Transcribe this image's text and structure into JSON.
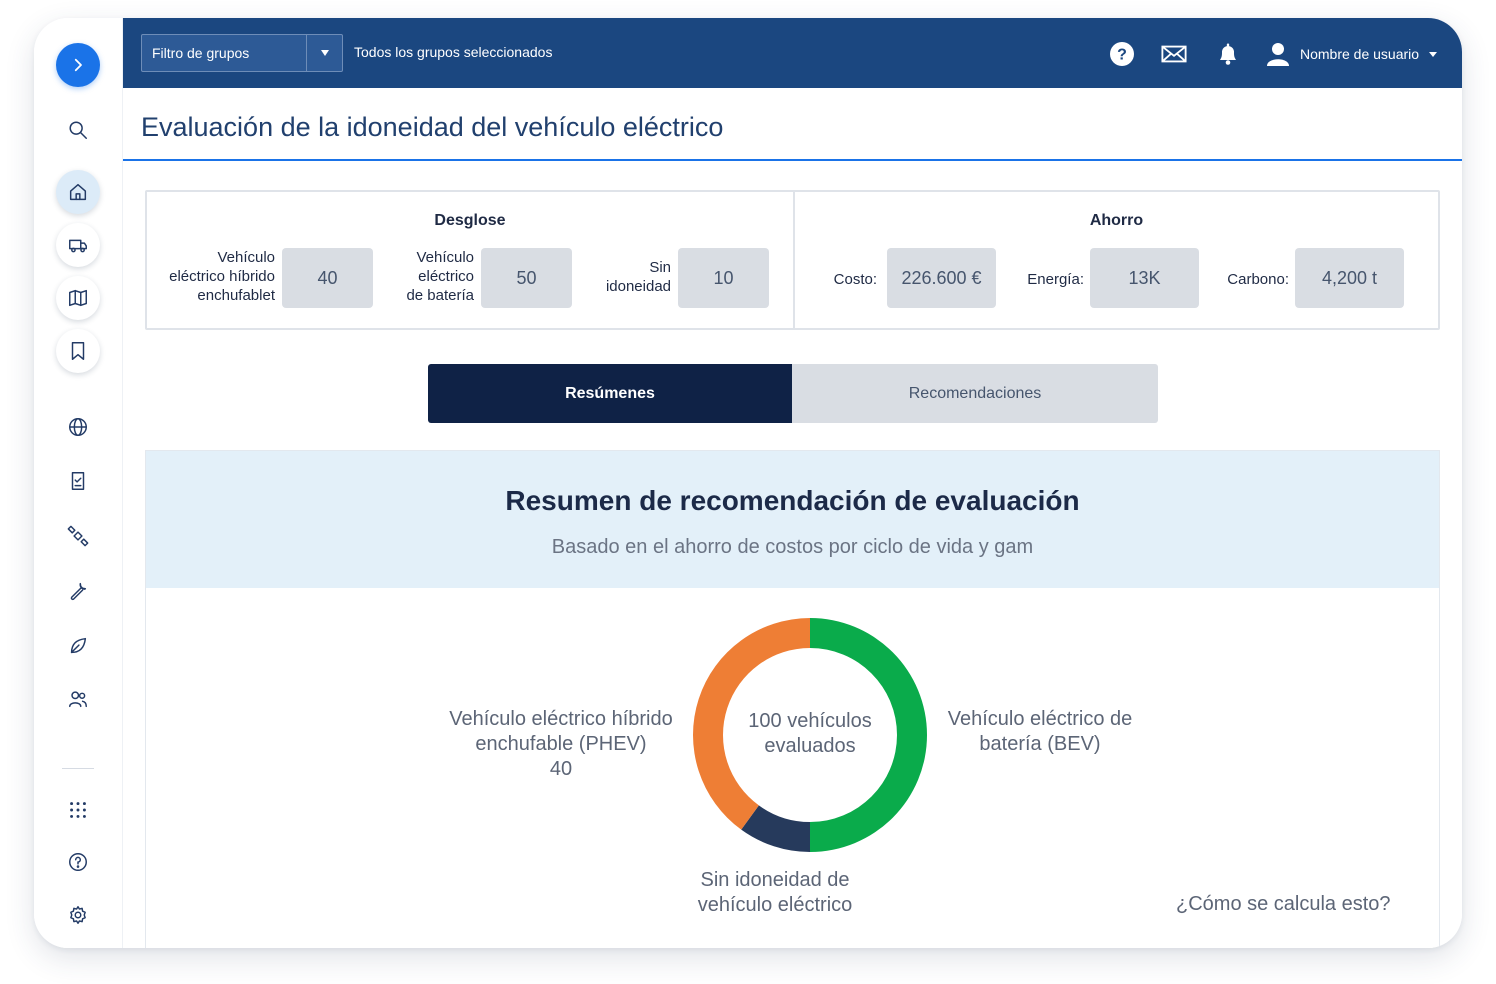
{
  "topbar": {
    "group_filter_label": "Filtro de grupos",
    "group_status": "Todos los grupos seleccionados",
    "help_icon": "question-circle-icon",
    "mail_icon": "envelope-icon",
    "bell_icon": "bell-icon",
    "user_icon": "user-icon",
    "username": "Nombre de usuario"
  },
  "sidebar": {
    "items": [
      {
        "icon": "expand-arrow-icon"
      },
      {
        "icon": "search-icon"
      },
      {
        "icon": "home-icon",
        "active": true
      },
      {
        "icon": "truck-icon"
      },
      {
        "icon": "map-icon"
      },
      {
        "icon": "bookmark-icon"
      },
      {
        "icon": "globe-icon"
      },
      {
        "icon": "report-icon"
      },
      {
        "icon": "satellite-icon"
      },
      {
        "icon": "wrench-icon"
      },
      {
        "icon": "leaf-icon"
      },
      {
        "icon": "users-icon"
      },
      {
        "icon": "apps-grid-icon"
      },
      {
        "icon": "help-icon"
      },
      {
        "icon": "settings-icon"
      }
    ]
  },
  "page": {
    "title": "Evaluación de la idoneidad del vehículo eléctrico"
  },
  "breakdown": {
    "title": "Desglose",
    "phev_label_1": "Vehículo",
    "phev_label_2": "eléctrico híbrido",
    "phev_label_3": "enchufablet",
    "phev_value": "40",
    "bev_label_1": "Vehículo",
    "bev_label_2": "eléctrico",
    "bev_label_3": "de batería",
    "bev_value": "50",
    "none_label_1": "Sin",
    "none_label_2": "idoneidad",
    "none_value": "10"
  },
  "savings": {
    "title": "Ahorro",
    "cost_label": "Costo:",
    "cost_value": "226.600 €",
    "energy_label": "Energía:",
    "energy_value": "13K",
    "carbon_label": "Carbono:",
    "carbon_value": "4,200 t"
  },
  "tabs": {
    "summaries": "Resúmenes",
    "recommendations": "Recomendaciones"
  },
  "card": {
    "title": "Resumen de recomendación de evaluación",
    "subtitle": "Basado en el ahorro de costos por ciclo de vida y gam",
    "center_line1": "100 vehículos",
    "center_line2": "evaluados",
    "phev_line1": "Vehículo eléctrico híbrido",
    "phev_line2": "enchufable (PHEV)",
    "phev_count": "40",
    "bev_line1": "Vehículo eléctrico de",
    "bev_line2": "batería (BEV)",
    "none_line1": "Sin idoneidad de",
    "none_line2": "vehículo eléctrico",
    "help_link": "¿Cómo se calcula esto?"
  },
  "chart_data": {
    "type": "pie",
    "donut": true,
    "categories": [
      "Vehículo eléctrico de batería (BEV)",
      "Sin idoneidad de vehículo eléctrico",
      "Vehículo eléctrico híbrido enchufable (PHEV)"
    ],
    "values": [
      50,
      10,
      40
    ],
    "colors": [
      "#0aab4b",
      "#263a5c",
      "#ee7e35"
    ],
    "start_angle_deg": 0,
    "center_label": "100 vehículos evaluados"
  }
}
